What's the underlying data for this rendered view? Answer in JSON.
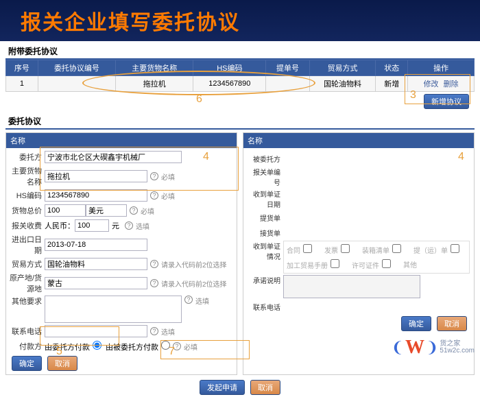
{
  "banner": {
    "title": "报关企业填写委托协议"
  },
  "section1": {
    "title": "附带委托协议",
    "headers": [
      "序号",
      "委托协议编号",
      "主要货物名称",
      "HS编码",
      "提单号",
      "贸易方式",
      "状态",
      "操作"
    ],
    "row": {
      "seq": "1",
      "agno": "",
      "goods": "拖拉机",
      "hs": "1234567890",
      "bl": "",
      "trade": "国轮油物料",
      "status": "新增",
      "op1": "修改",
      "op2": "删除"
    },
    "addBtn": "新增协议"
  },
  "section2": {
    "title": "委托协议"
  },
  "left": {
    "hd": "名称",
    "client_lbl": "委托方",
    "client_val": "宁波市北仑区大碶鑫宇机械厂",
    "goods_lbl": "主要货物名称",
    "goods_val": "拖拉机",
    "required": "必填",
    "hs_lbl": "HS编码",
    "hs_val": "1234567890",
    "price_lbl": "货物总价",
    "price_val": "100",
    "price_unit": "美元",
    "fee_lbl": "报关收费",
    "fee_cur": "人民币：",
    "fee_val": "100",
    "fee_unit": "元",
    "optional": "选填",
    "date_lbl": "进出口日期",
    "date_val": "2013-07-18",
    "trade_lbl": "贸易方式",
    "trade_val": "国轮油物料",
    "trade_hint": "请录入代码前2位选择",
    "origin_lbl": "原产地/货源地",
    "origin_val": "蒙古",
    "origin_hint": "请录入代码前2位选择",
    "other_lbl": "其他要求",
    "phone_lbl": "联系电话",
    "pay_lbl": "付款方",
    "pay_opt1": "由委托方付款",
    "pay_opt2": "由被委托方付款",
    "confirm": "确定",
    "cancel": "取消"
  },
  "right": {
    "hd": "名称",
    "ent_lbl": "被委托方",
    "decl_lbl": "报关单编号",
    "recv_lbl": "收到单证日期",
    "bl_lbl": "提货单",
    "inv_lbl": "接货单",
    "docs": {
      "contract": "合同",
      "invoice": "发票",
      "packing": "装箱清单",
      "trans": "提（运）单",
      "process": "加工贸易手册",
      "permit": "许可证件",
      "other": "其他"
    },
    "docs_lbl": "收到单证情况",
    "remark_lbl": "承诺说明",
    "phone_lbl": "联系电话",
    "confirm": "确定",
    "cancel": "取消"
  },
  "footer": {
    "send": "发起申请",
    "cancel": "取消"
  },
  "logo": {
    "brand": "货之家",
    "url": "51w2c.com"
  },
  "anno": {
    "n3": "3",
    "n4": "4",
    "n4b": "4",
    "n5": "5",
    "n6": "6",
    "n7": "7"
  }
}
